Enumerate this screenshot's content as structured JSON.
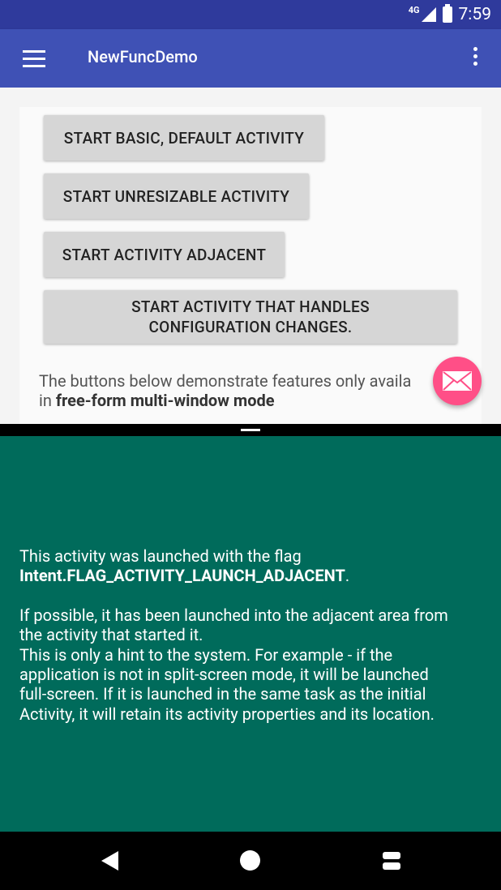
{
  "status_bar": {
    "network": "4G",
    "time": "7:59"
  },
  "app_bar": {
    "title": "NewFuncDemo"
  },
  "buttons": {
    "basic": "START BASIC, DEFAULT ACTIVITY",
    "unresizable": "START UNRESIZABLE ACTIVITY",
    "adjacent": "START ACTIVITY ADJACENT",
    "config_line1": "START ACTIVITY THAT HANDLES",
    "config_line2": "CONFIGURATION CHANGES."
  },
  "description": {
    "prefix": "The buttons below demonstrate features only availa",
    "line2_prefix": "in ",
    "line2_bold": "free-form multi-window mode"
  },
  "bottom": {
    "line1": "This activity was launched with the flag",
    "flag_name": "Intent.FLAG_ACTIVITY_LAUNCH_ADJACENT",
    "flag_suffix": ".",
    "para2_l1": "If possible, it has been launched into the adjacent area from",
    "para2_l2": "the activity that started it.",
    "para3_l1": "This is only a hint to the system. For example - if the",
    "para3_l2": "application is not in split-screen mode, it will be launched",
    "para3_l3": "full-screen. If it is launched in the same task as the initial",
    "para3_l4": "Activity, it will retain its activity properties and its location."
  },
  "colors": {
    "status_bar": "#2f3a9c",
    "app_bar": "#3f51b5",
    "fab": "#ff4f87",
    "bottom_pane": "#006b5b"
  },
  "icons": {
    "menu": "hamburger-menu-icon",
    "overflow": "more-vert-icon",
    "fab": "email-icon",
    "back": "back-icon",
    "home": "home-icon",
    "recents": "recents-icon"
  }
}
